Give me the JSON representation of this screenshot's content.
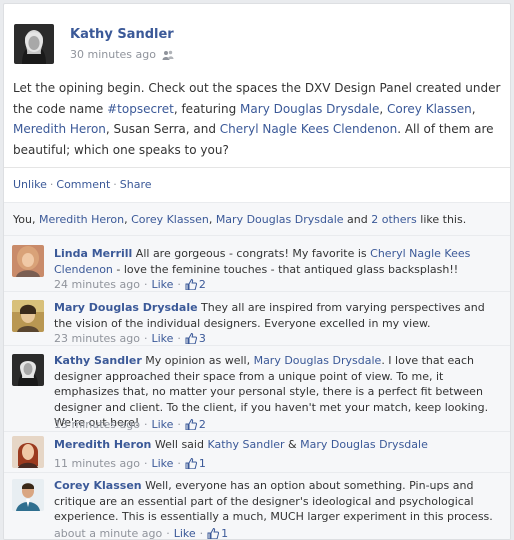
{
  "post": {
    "author": "Kathy Sandler",
    "time": "30 minutes ago",
    "audience_icon": "friends-icon",
    "text_intro": "Let the opining begin. Check out the spaces the DXV Design Panel created under the code name ",
    "hashtag": "#topsecret",
    "text_featuring": ", featuring ",
    "tag1": "Mary Douglas Drysdale",
    "sep1": ", ",
    "tag2": "Corey Klassen",
    "sep2": ", ",
    "tag3": "Meredith Heron",
    "text_mid": ", Susan Serra, and ",
    "tag4": "Cheryl Nagle Kees Clendenon",
    "text_end": ". All of them are beautiful; which one speaks to you?"
  },
  "actions": {
    "unlike": "Unlike",
    "comment": "Comment",
    "share": "Share",
    "dot": "·"
  },
  "likes": {
    "you": "You",
    "sep1": ", ",
    "p1": "Meredith Heron",
    "sep2": ", ",
    "p2": "Corey Klassen",
    "sep3": ", ",
    "p3": "Mary Douglas Drysdale",
    "and": " and ",
    "others": "2 others",
    "suffix": " like this."
  },
  "comments": [
    {
      "author": "Linda Merrill",
      "text1": " All are gorgeous - congrats! My favorite is ",
      "link": "Cheryl Nagle Kees Clendenon",
      "text2": " - love the feminine touches - that antiqued glass backsplash!!",
      "time": "24 minutes ago",
      "like": "Like",
      "likes": "2"
    },
    {
      "author": "Mary Douglas Drysdale",
      "text1": " They all are inspired from varying perspectives and the vision of the individual designers. Everyone excelled in my view.",
      "time": "23 minutes ago",
      "like": "Like",
      "likes": "3"
    },
    {
      "author": "Kathy Sandler",
      "text1": " My opinion as well, ",
      "link": "Mary Douglas Drysdale",
      "text2": ". I love that each designer approached their space from a unique point of view. To me, it emphasizes that, no matter your personal style, there is a perfect fit between designer and client. To the client, if you haven't met your match, keep looking. We're out here!",
      "time": "13 minutes ago",
      "like": "Like",
      "likes": "2"
    },
    {
      "author": "Meredith Heron",
      "text1": " Well said ",
      "link": "Kathy Sandler",
      "text_amp": " & ",
      "link2": "Mary Douglas Drysdale",
      "time": "11 minutes ago",
      "like": "Like",
      "likes": "1"
    },
    {
      "author": "Corey Klassen",
      "text1": " Well, everyone has an option about something. Pin-ups and critique are an essential part of the designer's ideological and psychological experience. This is essentially a much, MUCH larger experiment in this process.",
      "time": "about a minute ago",
      "like": "Like",
      "likes": "1"
    }
  ],
  "colors": {
    "link": "#3b5998",
    "meta": "#90949c",
    "panel": "#f6f7f9"
  }
}
